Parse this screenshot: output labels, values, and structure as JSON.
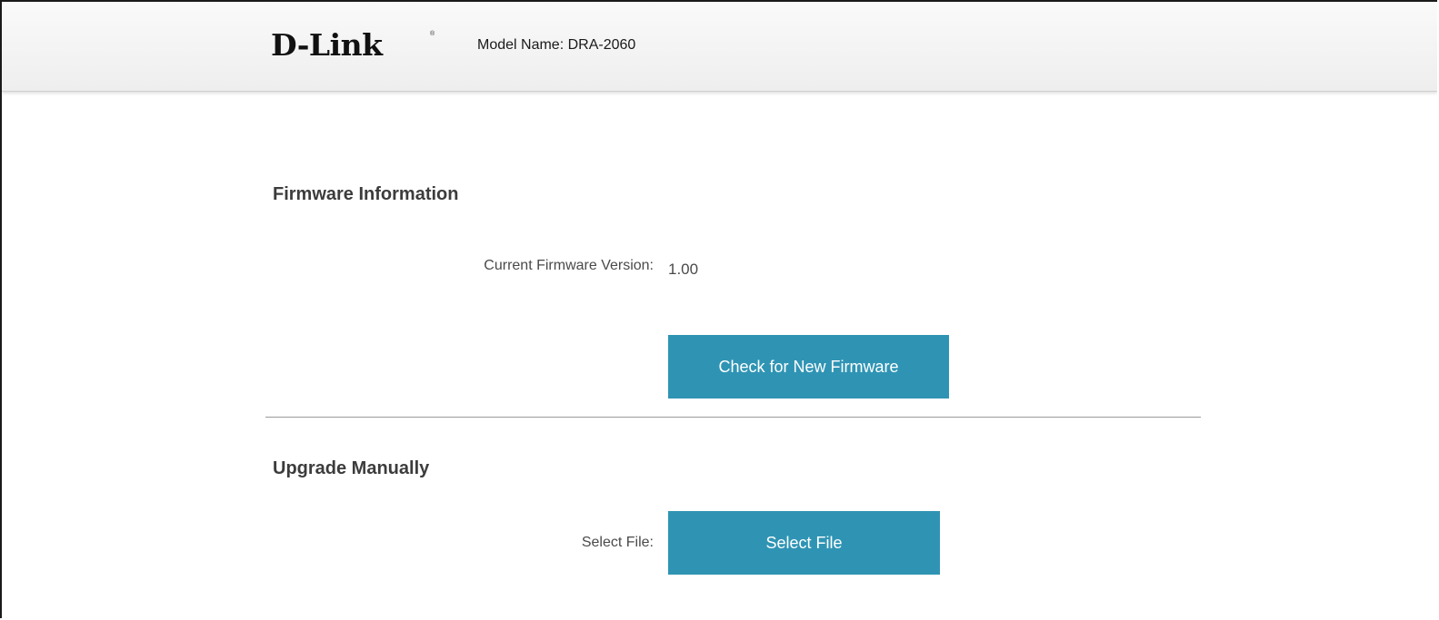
{
  "header": {
    "logo_text": "D-Link",
    "logo_registered": "®",
    "model_name": "Model Name: DRA-2060"
  },
  "firmware_information": {
    "title": "Firmware Information",
    "current_version_label": "Current Firmware Version:",
    "current_version_value": "1.00",
    "check_button_label": "Check for New Firmware"
  },
  "upgrade_manually": {
    "title": "Upgrade Manually",
    "select_file_label": "Select File:",
    "select_file_button_label": "Select File"
  },
  "colors": {
    "button_background": "#2f94b4",
    "button_text": "#ffffff",
    "header_background": "#f3f3f3"
  }
}
